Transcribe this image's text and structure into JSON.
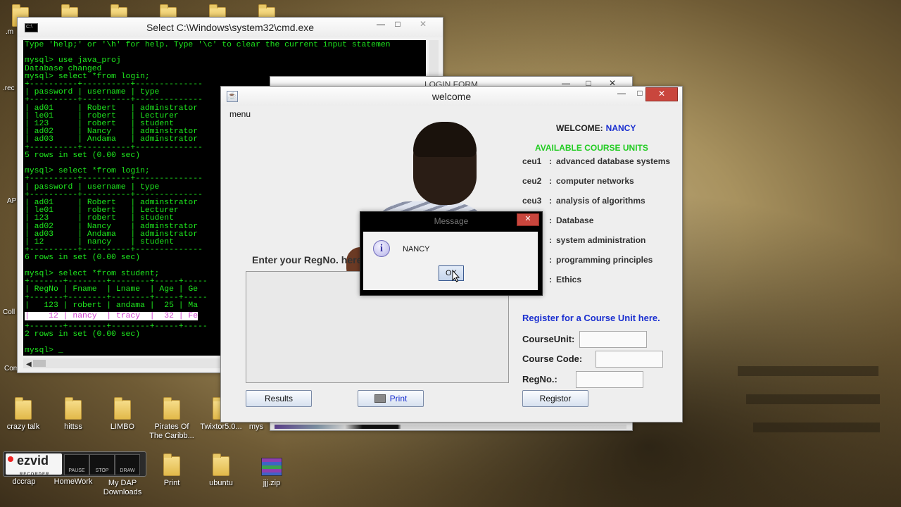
{
  "desktop": {
    "left_edge_labels": [
      ".m",
      ".rec",
      "AP",
      "Coll",
      "Com"
    ],
    "bottom_icons": [
      {
        "label": "crazy talk",
        "type": "folder"
      },
      {
        "label": "hittss",
        "type": "folder"
      },
      {
        "label": "LIMBO",
        "type": "folder"
      },
      {
        "label": "Pirates Of The Caribb...",
        "type": "folder"
      },
      {
        "label": "Twixtor5.0...",
        "type": "folder"
      },
      {
        "label": "mys",
        "type": "folder"
      },
      {
        "label": "dccrap",
        "type": "folder"
      },
      {
        "label": "HomeWork",
        "type": "folder"
      },
      {
        "label": "My DAP Downloads",
        "type": "folder"
      },
      {
        "label": "Print",
        "type": "folder"
      },
      {
        "label": "ubuntu",
        "type": "folder"
      },
      {
        "label": "jjj.zip",
        "type": "zip"
      }
    ]
  },
  "cmd_window": {
    "title": "Select C:\\Windows\\system32\\cmd.exe",
    "icon": "console-icon",
    "console_lines_a": "Type 'help;' or '\\h' for help. Type '\\c' to clear the current input statemen\n\nmysql> use java_proj\nDatabase changed\nmysql> select *from login;\n+----------+----------+--------------\n| password | username | type\n+----------+----------+--------------\n| ad01     | Robert   | adminstrator\n| le01     | robert   | Lecturer\n| 123      | robert   | student\n| ad02     | Nancy    | adminstrator\n| ad03     | Andama   | adminstrator\n+----------+----------+--------------\n5 rows in set (0.00 sec)\n\nmysql> select *from login;\n+----------+----------+--------------\n| password | username | type\n+----------+----------+--------------\n| ad01     | Robert   | adminstrator\n| le01     | robert   | Lecturer\n| 123      | robert   | student\n| ad02     | Nancy    | adminstrator\n| ad03     | Andama   | adminstrator\n| 12       | nancy    | student\n+----------+----------+--------------\n6 rows in set (0.00 sec)\n\nmysql> select *from student;\n+-------+--------+--------+-----+-----\n| RegNo | Fname  | Lname  | Age | Ge\n+-------+--------+--------+-----+-----\n|   123 | robert | andama |  25 | Ma",
    "console_highlight": "|    12 | nancy  | tracy  |  32 | Fe",
    "console_lines_b": "+-------+--------+--------+-----+-----\n2 rows in set (0.00 sec)\n\nmysql> _"
  },
  "login_window": {
    "title": "LOGIN FORM"
  },
  "welcome_window": {
    "title": "welcome",
    "menu": "menu",
    "welcome_label": "WELCOME:",
    "welcome_name": "NANCY",
    "available_heading": "AVAILABLE COURSE UNITS",
    "courses": [
      {
        "code": "ceu1",
        "sep": ":",
        "name": "advanced database systems"
      },
      {
        "code": "ceu2",
        "sep": ":",
        "name": "computer networks"
      },
      {
        "code": "ceu3",
        "sep": ":",
        "name": "analysis of algorithms"
      },
      {
        "code": "",
        "sep": ":",
        "name": "Database"
      },
      {
        "code": "",
        "sep": ":",
        "name": "system administration"
      },
      {
        "code": "",
        "sep": ":",
        "name": "programming principles"
      },
      {
        "code": "",
        "sep": ":",
        "name": "Ethics"
      }
    ],
    "enter_regno": "Enter your RegNo. here",
    "results_button": "Results",
    "print_button": "Print",
    "register_heading": "Register for a Course Unit here.",
    "course_unit_label": "CourseUnit:",
    "course_code_label": "Course Code:",
    "regno_label": "RegNo.:",
    "course_unit_value": "",
    "course_code_value": "",
    "regno_value": "",
    "register_button": "Registor"
  },
  "message_dialog": {
    "title": "Message",
    "text": "NANCY",
    "ok": "OK",
    "close": "✕"
  },
  "recorder": {
    "brand": "ezvid",
    "sub": "RECORDER",
    "buttons": [
      "PAUSE",
      "STOP",
      "DRAW"
    ]
  },
  "colors": {
    "console_text": "#1ee81e",
    "welcome_name": "#1a2fd0",
    "available": "#22cc22",
    "close_button": "#c9463d"
  }
}
